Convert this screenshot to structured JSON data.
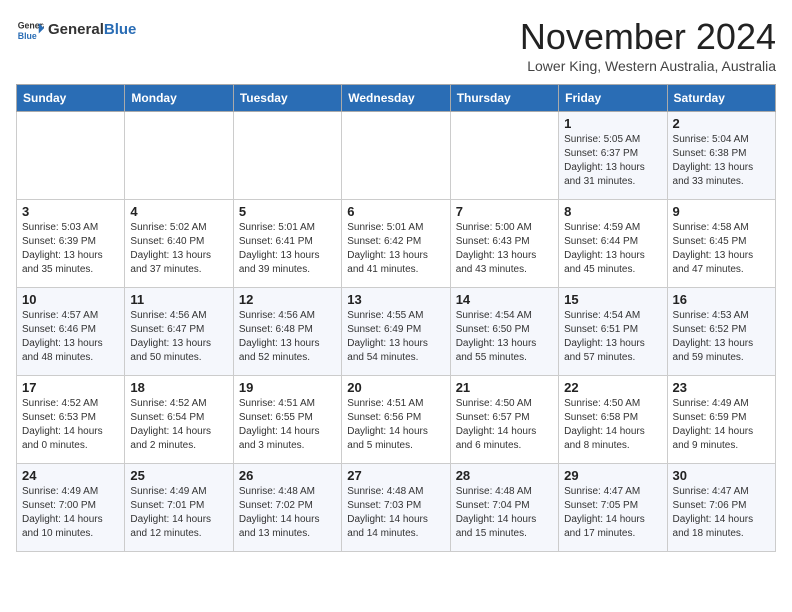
{
  "logo": {
    "general": "General",
    "blue": "Blue"
  },
  "title": "November 2024",
  "subtitle": "Lower King, Western Australia, Australia",
  "days_of_week": [
    "Sunday",
    "Monday",
    "Tuesday",
    "Wednesday",
    "Thursday",
    "Friday",
    "Saturday"
  ],
  "weeks": [
    [
      {
        "day": "",
        "info": ""
      },
      {
        "day": "",
        "info": ""
      },
      {
        "day": "",
        "info": ""
      },
      {
        "day": "",
        "info": ""
      },
      {
        "day": "",
        "info": ""
      },
      {
        "day": "1",
        "info": "Sunrise: 5:05 AM\nSunset: 6:37 PM\nDaylight: 13 hours and 31 minutes."
      },
      {
        "day": "2",
        "info": "Sunrise: 5:04 AM\nSunset: 6:38 PM\nDaylight: 13 hours and 33 minutes."
      }
    ],
    [
      {
        "day": "3",
        "info": "Sunrise: 5:03 AM\nSunset: 6:39 PM\nDaylight: 13 hours and 35 minutes."
      },
      {
        "day": "4",
        "info": "Sunrise: 5:02 AM\nSunset: 6:40 PM\nDaylight: 13 hours and 37 minutes."
      },
      {
        "day": "5",
        "info": "Sunrise: 5:01 AM\nSunset: 6:41 PM\nDaylight: 13 hours and 39 minutes."
      },
      {
        "day": "6",
        "info": "Sunrise: 5:01 AM\nSunset: 6:42 PM\nDaylight: 13 hours and 41 minutes."
      },
      {
        "day": "7",
        "info": "Sunrise: 5:00 AM\nSunset: 6:43 PM\nDaylight: 13 hours and 43 minutes."
      },
      {
        "day": "8",
        "info": "Sunrise: 4:59 AM\nSunset: 6:44 PM\nDaylight: 13 hours and 45 minutes."
      },
      {
        "day": "9",
        "info": "Sunrise: 4:58 AM\nSunset: 6:45 PM\nDaylight: 13 hours and 47 minutes."
      }
    ],
    [
      {
        "day": "10",
        "info": "Sunrise: 4:57 AM\nSunset: 6:46 PM\nDaylight: 13 hours and 48 minutes."
      },
      {
        "day": "11",
        "info": "Sunrise: 4:56 AM\nSunset: 6:47 PM\nDaylight: 13 hours and 50 minutes."
      },
      {
        "day": "12",
        "info": "Sunrise: 4:56 AM\nSunset: 6:48 PM\nDaylight: 13 hours and 52 minutes."
      },
      {
        "day": "13",
        "info": "Sunrise: 4:55 AM\nSunset: 6:49 PM\nDaylight: 13 hours and 54 minutes."
      },
      {
        "day": "14",
        "info": "Sunrise: 4:54 AM\nSunset: 6:50 PM\nDaylight: 13 hours and 55 minutes."
      },
      {
        "day": "15",
        "info": "Sunrise: 4:54 AM\nSunset: 6:51 PM\nDaylight: 13 hours and 57 minutes."
      },
      {
        "day": "16",
        "info": "Sunrise: 4:53 AM\nSunset: 6:52 PM\nDaylight: 13 hours and 59 minutes."
      }
    ],
    [
      {
        "day": "17",
        "info": "Sunrise: 4:52 AM\nSunset: 6:53 PM\nDaylight: 14 hours and 0 minutes."
      },
      {
        "day": "18",
        "info": "Sunrise: 4:52 AM\nSunset: 6:54 PM\nDaylight: 14 hours and 2 minutes."
      },
      {
        "day": "19",
        "info": "Sunrise: 4:51 AM\nSunset: 6:55 PM\nDaylight: 14 hours and 3 minutes."
      },
      {
        "day": "20",
        "info": "Sunrise: 4:51 AM\nSunset: 6:56 PM\nDaylight: 14 hours and 5 minutes."
      },
      {
        "day": "21",
        "info": "Sunrise: 4:50 AM\nSunset: 6:57 PM\nDaylight: 14 hours and 6 minutes."
      },
      {
        "day": "22",
        "info": "Sunrise: 4:50 AM\nSunset: 6:58 PM\nDaylight: 14 hours and 8 minutes."
      },
      {
        "day": "23",
        "info": "Sunrise: 4:49 AM\nSunset: 6:59 PM\nDaylight: 14 hours and 9 minutes."
      }
    ],
    [
      {
        "day": "24",
        "info": "Sunrise: 4:49 AM\nSunset: 7:00 PM\nDaylight: 14 hours and 10 minutes."
      },
      {
        "day": "25",
        "info": "Sunrise: 4:49 AM\nSunset: 7:01 PM\nDaylight: 14 hours and 12 minutes."
      },
      {
        "day": "26",
        "info": "Sunrise: 4:48 AM\nSunset: 7:02 PM\nDaylight: 14 hours and 13 minutes."
      },
      {
        "day": "27",
        "info": "Sunrise: 4:48 AM\nSunset: 7:03 PM\nDaylight: 14 hours and 14 minutes."
      },
      {
        "day": "28",
        "info": "Sunrise: 4:48 AM\nSunset: 7:04 PM\nDaylight: 14 hours and 15 minutes."
      },
      {
        "day": "29",
        "info": "Sunrise: 4:47 AM\nSunset: 7:05 PM\nDaylight: 14 hours and 17 minutes."
      },
      {
        "day": "30",
        "info": "Sunrise: 4:47 AM\nSunset: 7:06 PM\nDaylight: 14 hours and 18 minutes."
      }
    ]
  ]
}
